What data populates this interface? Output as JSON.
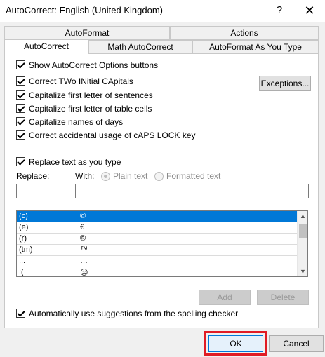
{
  "window": {
    "title": "AutoCorrect: English (United Kingdom)",
    "help_glyph": "?",
    "close_glyph": "✕"
  },
  "tabs": {
    "row1": [
      {
        "label": "AutoFormat"
      },
      {
        "label": "Actions"
      }
    ],
    "row2": [
      {
        "label": "AutoCorrect",
        "active": true
      },
      {
        "label": "Math AutoCorrect"
      },
      {
        "label": "AutoFormat As You Type"
      }
    ]
  },
  "options": {
    "show_buttons": {
      "label": "Show AutoCorrect Options buttons",
      "checked": true
    },
    "correct_two_initial": {
      "label": "Correct TWo INitial CApitals",
      "checked": true
    },
    "capitalize_sentences": {
      "label": "Capitalize first letter of sentences",
      "checked": true
    },
    "capitalize_table_cells": {
      "label": "Capitalize first letter of table cells",
      "checked": true
    },
    "capitalize_days": {
      "label": "Capitalize names of days",
      "checked": true
    },
    "caps_lock": {
      "label": "Correct accidental usage of cAPS LOCK key",
      "checked": true
    },
    "exceptions_button": "Exceptions...",
    "replace_as_you_type": {
      "label": "Replace text as you type",
      "checked": true
    },
    "auto_suggestions": {
      "label": "Automatically use suggestions from the spelling checker",
      "checked": true
    }
  },
  "replace": {
    "replace_label": "Replace:",
    "with_label": "With:",
    "plain_text": "Plain text",
    "formatted_text": "Formatted text",
    "replace_value": "",
    "with_value": ""
  },
  "list": {
    "rows": [
      {
        "from": "(c)",
        "to": "©",
        "selected": true
      },
      {
        "from": "(e)",
        "to": "€"
      },
      {
        "from": "(r)",
        "to": "®"
      },
      {
        "from": "(tm)",
        "to": "™"
      },
      {
        "from": "...",
        "to": "…"
      },
      {
        "from": ":(",
        "to": "☹"
      }
    ]
  },
  "buttons": {
    "add": "Add",
    "delete": "Delete",
    "ok": "OK",
    "cancel": "Cancel"
  },
  "colors": {
    "selection": "#0078d7",
    "highlight_box": "#e01b24"
  }
}
